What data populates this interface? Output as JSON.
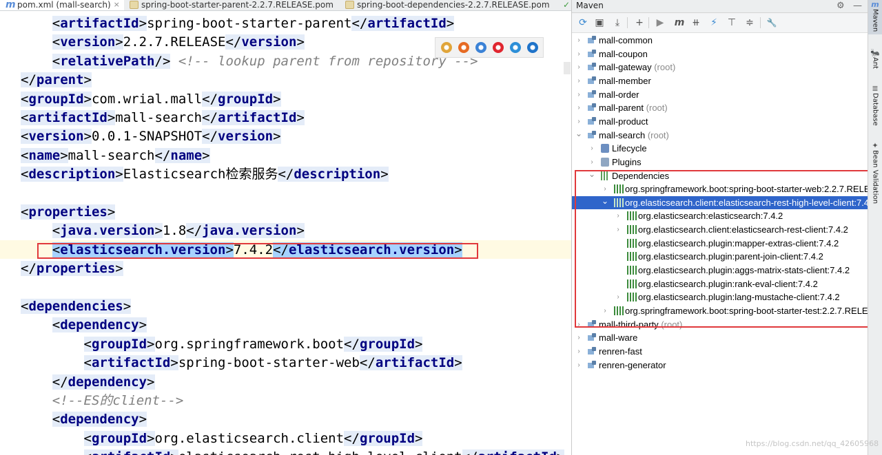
{
  "tabs": [
    {
      "label": "pom.xml (mall-search)",
      "icon": "maven-m-icon",
      "active": true
    },
    {
      "label": "spring-boot-starter-parent-2.2.7.RELEASE.pom",
      "icon": "maven-file-icon",
      "active": false
    },
    {
      "label": "spring-boot-dependencies-2.2.7.RELEASE.pom",
      "icon": "maven-file-icon",
      "active": false
    }
  ],
  "tab_close": "×",
  "tab_m": "m",
  "check_glyph": "✓",
  "code_lines": [
    {
      "indent": "    ",
      "tag": "artifactId",
      "text": "spring-boot-starter-parent"
    },
    {
      "indent": "    ",
      "tag": "version",
      "text": "2.2.7.RELEASE"
    },
    {
      "indent": "    ",
      "tag": "relativePath",
      "self_closing": true,
      "comment": "<!-- lookup parent from repository -->"
    },
    {
      "indent": "",
      "close_tag": "parent"
    },
    {
      "indent": "",
      "tag": "groupId",
      "text": "com.wrial.mall"
    },
    {
      "indent": "",
      "tag": "artifactId",
      "text": "mall-search"
    },
    {
      "indent": "",
      "tag": "version",
      "text": "0.0.1-SNAPSHOT"
    },
    {
      "indent": "",
      "tag": "name",
      "text": "mall-search"
    },
    {
      "indent": "",
      "tag": "description",
      "text": "Elasticsearch检索服务"
    },
    {
      "indent": "",
      "empty": true
    },
    {
      "indent": "",
      "open_tag": "properties"
    },
    {
      "indent": "    ",
      "tag": "java.version",
      "text": "1.8"
    },
    {
      "indent": "    ",
      "tag": "elasticsearch.version",
      "text": "7.4.2",
      "highlighted": true
    },
    {
      "indent": "",
      "close_tag": "properties"
    },
    {
      "indent": "",
      "empty": true
    },
    {
      "indent": "",
      "open_tag": "dependencies"
    },
    {
      "indent": "    ",
      "open_tag": "dependency"
    },
    {
      "indent": "        ",
      "tag": "groupId",
      "text": "org.springframework.boot"
    },
    {
      "indent": "        ",
      "tag": "artifactId",
      "text": "spring-boot-starter-web"
    },
    {
      "indent": "    ",
      "close_tag": "dependency"
    },
    {
      "indent": "    ",
      "comment": "<!--ES的client-->"
    },
    {
      "indent": "    ",
      "open_tag": "dependency"
    },
    {
      "indent": "        ",
      "tag": "groupId",
      "text": "org.elasticsearch.client"
    },
    {
      "indent": "        ",
      "tag": "artifactId",
      "text": "elasticsearch-rest-high-level-client"
    }
  ],
  "browser_icons": [
    {
      "name": "chrome-icon",
      "color": "#e0a53a"
    },
    {
      "name": "firefox-icon",
      "color": "#e66a23"
    },
    {
      "name": "safari-icon",
      "color": "#3b82d6"
    },
    {
      "name": "opera-icon",
      "color": "#e0262f"
    },
    {
      "name": "ie-icon",
      "color": "#2d8fd8"
    },
    {
      "name": "edge-icon",
      "color": "#1f73c9"
    }
  ],
  "maven": {
    "title": "Maven",
    "settings_glyph": "⚙",
    "minimize_glyph": "—",
    "toolbar": [
      {
        "name": "reload-icon",
        "glyph": "⟳"
      },
      {
        "name": "add-folder-icon",
        "glyph": "▣"
      },
      {
        "name": "download-icon",
        "glyph": "⤓"
      },
      {
        "name": "add-icon",
        "glyph": "+"
      },
      {
        "name": "run-icon",
        "glyph": "▶"
      },
      {
        "name": "execute-goal-icon",
        "glyph": "m"
      },
      {
        "name": "toggle-offline-icon",
        "glyph": "⧺"
      },
      {
        "name": "skip-tests-icon",
        "glyph": "⚡"
      },
      {
        "name": "show-dependencies-icon",
        "glyph": "⊤"
      },
      {
        "name": "collapse-all-icon",
        "glyph": "≑"
      },
      {
        "name": "settings-wrench-icon",
        "glyph": "🔧"
      }
    ],
    "tree": [
      {
        "label": "mall-common",
        "depth": 0,
        "arrow": "›",
        "icon": "module"
      },
      {
        "label": "mall-coupon",
        "depth": 0,
        "arrow": "›",
        "icon": "module"
      },
      {
        "label": "mall-gateway",
        "root": "(root)",
        "depth": 0,
        "arrow": "›",
        "icon": "module"
      },
      {
        "label": "mall-member",
        "depth": 0,
        "arrow": "›",
        "icon": "module"
      },
      {
        "label": "mall-order",
        "depth": 0,
        "arrow": "›",
        "icon": "module"
      },
      {
        "label": "mall-parent",
        "root": "(root)",
        "depth": 0,
        "arrow": "›",
        "icon": "module"
      },
      {
        "label": "mall-product",
        "depth": 0,
        "arrow": "›",
        "icon": "module"
      },
      {
        "label": "mall-search",
        "root": "(root)",
        "depth": 0,
        "arrow": "⌄",
        "icon": "module"
      },
      {
        "label": "Lifecycle",
        "depth": 1,
        "arrow": "›",
        "icon": "lifecycle"
      },
      {
        "label": "Plugins",
        "depth": 1,
        "arrow": "›",
        "icon": "plugins"
      },
      {
        "label": "Dependencies",
        "depth": 1,
        "arrow": "⌄",
        "icon": "deps"
      },
      {
        "label": "org.springframework.boot:spring-boot-starter-web:2.2.7.RELE",
        "depth": 2,
        "arrow": "›",
        "icon": "lib"
      },
      {
        "label": "org.elasticsearch.client:elasticsearch-rest-high-level-client:7.4",
        "depth": 2,
        "arrow": "⌄",
        "icon": "lib",
        "selected": true
      },
      {
        "label": "org.elasticsearch:elasticsearch:7.4.2",
        "depth": 3,
        "arrow": "›",
        "icon": "lib"
      },
      {
        "label": "org.elasticsearch.client:elasticsearch-rest-client:7.4.2",
        "depth": 3,
        "arrow": "›",
        "icon": "lib"
      },
      {
        "label": "org.elasticsearch.plugin:mapper-extras-client:7.4.2",
        "depth": 3,
        "arrow": "",
        "icon": "lib"
      },
      {
        "label": "org.elasticsearch.plugin:parent-join-client:7.4.2",
        "depth": 3,
        "arrow": "",
        "icon": "lib"
      },
      {
        "label": "org.elasticsearch.plugin:aggs-matrix-stats-client:7.4.2",
        "depth": 3,
        "arrow": "",
        "icon": "lib"
      },
      {
        "label": "org.elasticsearch.plugin:rank-eval-client:7.4.2",
        "depth": 3,
        "arrow": "",
        "icon": "lib"
      },
      {
        "label": "org.elasticsearch.plugin:lang-mustache-client:7.4.2",
        "depth": 3,
        "arrow": "›",
        "icon": "lib"
      },
      {
        "label": "org.springframework.boot:spring-boot-starter-test:2.2.7.RELE",
        "depth": 2,
        "arrow": "›",
        "icon": "lib"
      },
      {
        "label": "mall-third-party",
        "root": "(root)",
        "depth": 0,
        "arrow": "›",
        "icon": "module"
      },
      {
        "label": "mall-ware",
        "depth": 0,
        "arrow": "›",
        "icon": "module"
      },
      {
        "label": "renren-fast",
        "depth": 0,
        "arrow": "›",
        "icon": "module"
      },
      {
        "label": "renren-generator",
        "depth": 0,
        "arrow": "›",
        "icon": "module"
      }
    ]
  },
  "side_strip": [
    {
      "label": "Maven",
      "icon": "m",
      "name": "maven-tool-button",
      "active": true
    },
    {
      "label": "Ant",
      "icon": "🐜",
      "name": "ant-tool-button",
      "active": false
    },
    {
      "label": "Database",
      "icon": "≣",
      "name": "database-tool-button",
      "active": false
    },
    {
      "label": "Bean Validation",
      "icon": "✦",
      "name": "bean-validation-tool-button",
      "active": false
    }
  ],
  "watermark": "https://blog.csdn.net/qq_42605968",
  "colors": {
    "tag": "#000080",
    "selection": "#a6d2ff",
    "tree_selected": "#2f65ca",
    "highlight_box": "#e0383b",
    "root_gray": "#8a8a8a"
  }
}
